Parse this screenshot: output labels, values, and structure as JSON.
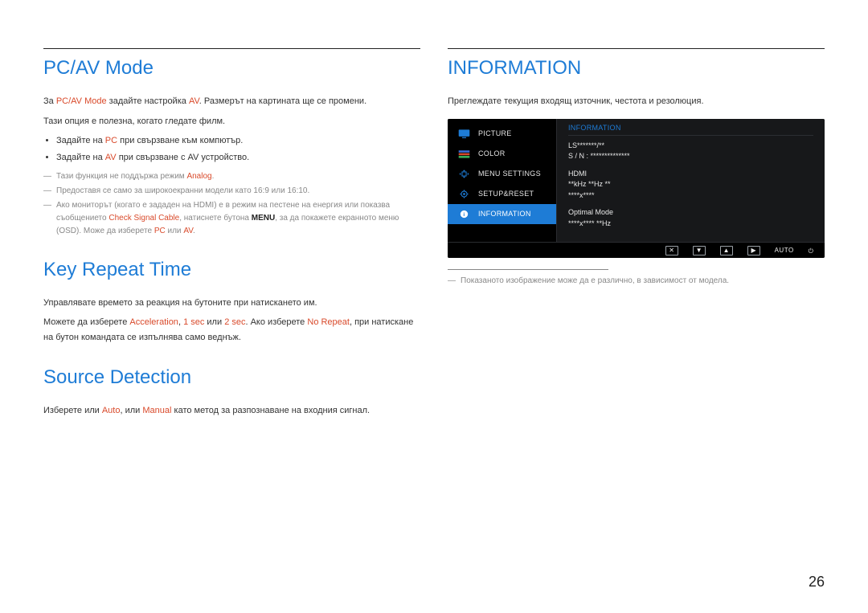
{
  "page_number": "26",
  "left": {
    "section1": "PC/AV Mode",
    "p1_a": "За ",
    "p1_b": "PC/AV Mode",
    "p1_c": " задайте настройка ",
    "p1_d": "AV",
    "p1_e": ". Размерът на картината ще се промени.",
    "p2": "Тази опция е полезна, когато гледате филм.",
    "b1_a": "Задайте на ",
    "b1_b": "PC",
    "b1_c": " при свързване към компютър.",
    "b2_a": "Задайте на ",
    "b2_b": "AV",
    "b2_c": " при свързване с AV устройство.",
    "fn1_a": "Тази функция не поддържа режим ",
    "fn1_b": "Analog",
    "fn1_c": ".",
    "fn2": "Предоставя се само за широкоекранни модели като 16:9 или 16:10.",
    "fn3_a": "Ако мониторът (когато е зададен на HDMI) е в режим на пестене на енергия или показва съобщението ",
    "fn3_b": "Check Signal Cable",
    "fn3_c": ", натиснете бутона ",
    "fn3_d": "MENU",
    "fn3_e": ", за да покажете екранното меню (OSD). Може да изберете ",
    "fn3_f": "PC",
    "fn3_g": " или ",
    "fn3_h": "AV",
    "fn3_i": ".",
    "section2": "Key Repeat Time",
    "krt_p1": "Управлявате времето за реакция на бутоните при натискането им.",
    "krt_p2_a": "Можете да изберете ",
    "krt_p2_b": "Acceleration",
    "krt_p2_c": ", ",
    "krt_p2_d": "1 sec",
    "krt_p2_e": " или ",
    "krt_p2_f": "2 sec",
    "krt_p2_g": ". Ако изберете ",
    "krt_p2_h": "No Repeat",
    "krt_p2_i": ", при натискане на бутон командата се изпълнява само веднъж.",
    "section3": "Source Detection",
    "sd_p1_a": "Изберете или ",
    "sd_p1_b": "Auto",
    "sd_p1_c": ", или ",
    "sd_p1_d": "Manual",
    "sd_p1_e": " като метод за разпознаване на входния сигнал."
  },
  "right": {
    "section1": "INFORMATION",
    "p1": "Преглеждате текущия входящ източник, честота и резолюция.",
    "osd": {
      "menu": {
        "picture": "PICTURE",
        "color": "COLOR",
        "menusettings": "MENU SETTINGS",
        "setupreset": "SETUP&RESET",
        "information": "INFORMATION"
      },
      "panel_title": "INFORMATION",
      "line1": "LS*******/**",
      "line2": "S / N : **************",
      "line3": "HDMI",
      "line4": "**kHz **Hz **",
      "line5": "****x****",
      "line6": "Optimal Mode",
      "line7": "****x**** **Hz",
      "auto_label": "AUTO"
    },
    "fn1": "Показаното изображение може да е различно, в зависимост от модела."
  }
}
